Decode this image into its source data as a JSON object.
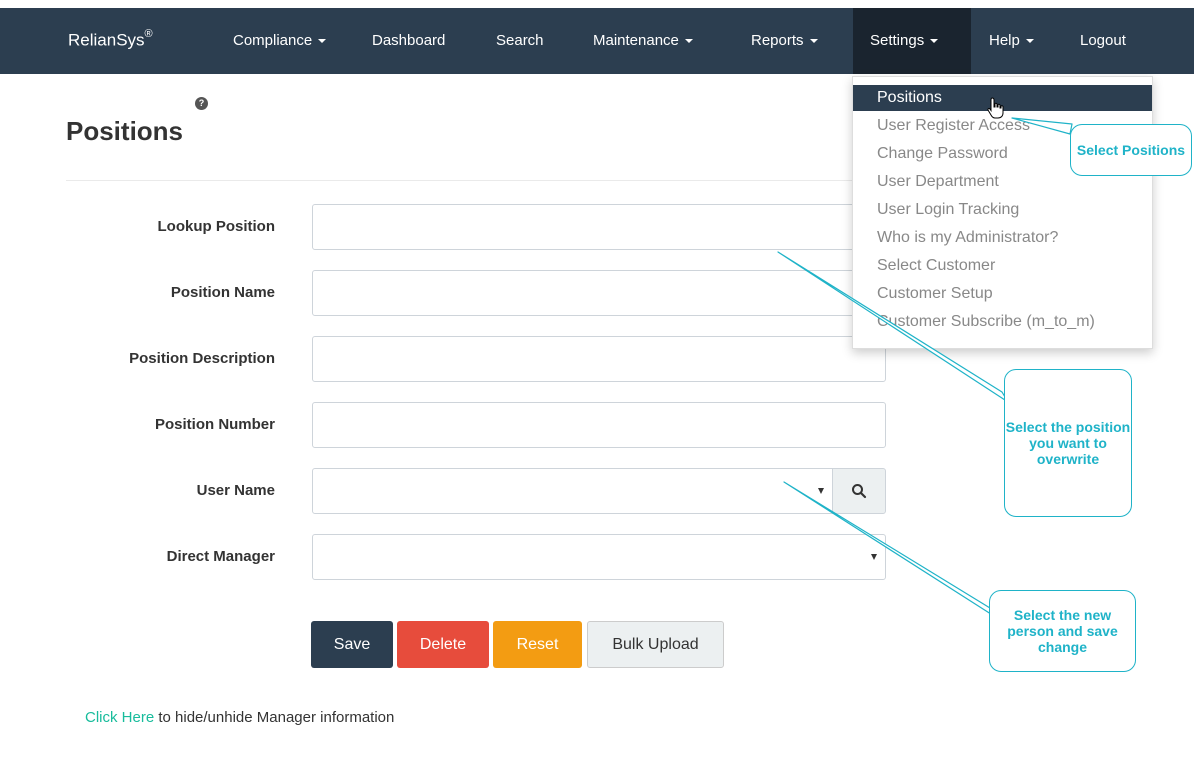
{
  "navbar": {
    "brand": "RelianSys",
    "brand_mark": "®",
    "items": [
      {
        "label": "Compliance",
        "has_caret": true
      },
      {
        "label": "Dashboard",
        "has_caret": false
      },
      {
        "label": "Search",
        "has_caret": false
      },
      {
        "label": "Maintenance",
        "has_caret": true
      },
      {
        "label": "Reports",
        "has_caret": true
      },
      {
        "label": "Settings",
        "has_caret": true
      },
      {
        "label": "Help",
        "has_caret": true
      },
      {
        "label": "Logout",
        "has_caret": false
      }
    ],
    "active_item": "Settings"
  },
  "page": {
    "title": "Positions",
    "help_glyph": "?"
  },
  "form": {
    "lookup_position": {
      "label": "Lookup Position",
      "value": ""
    },
    "position_name": {
      "label": "Position Name",
      "value": ""
    },
    "position_description": {
      "label": "Position Description",
      "value": ""
    },
    "position_number": {
      "label": "Position Number",
      "value": ""
    },
    "user_name": {
      "label": "User Name",
      "value": ""
    },
    "direct_manager": {
      "label": "Direct Manager",
      "value": ""
    }
  },
  "buttons": {
    "save": "Save",
    "delete": "Delete",
    "reset": "Reset",
    "bulk_upload": "Bulk Upload"
  },
  "footer": {
    "link_text": "Click Here",
    "rest_text": " to hide/unhide Manager information"
  },
  "settings_menu": {
    "items": [
      "Positions",
      "User Register Access",
      "Change Password",
      "User Department",
      "User Login Tracking",
      "Who is my Administrator?",
      "Select Customer",
      "Customer Setup",
      "Customer Subscribe (m_to_m)"
    ],
    "highlighted": "Positions"
  },
  "callouts": {
    "select_positions": "Select Positions",
    "select_position_overwrite": "Select the position you want to overwrite",
    "select_new_person": "Select the new person and save change"
  },
  "colors": {
    "navbar": "#2c3e50",
    "navbar_active": "#1a242f",
    "link": "#18bc9c",
    "delete": "#e74c3c",
    "reset": "#f39c12",
    "callout": "#1fb3c8"
  }
}
